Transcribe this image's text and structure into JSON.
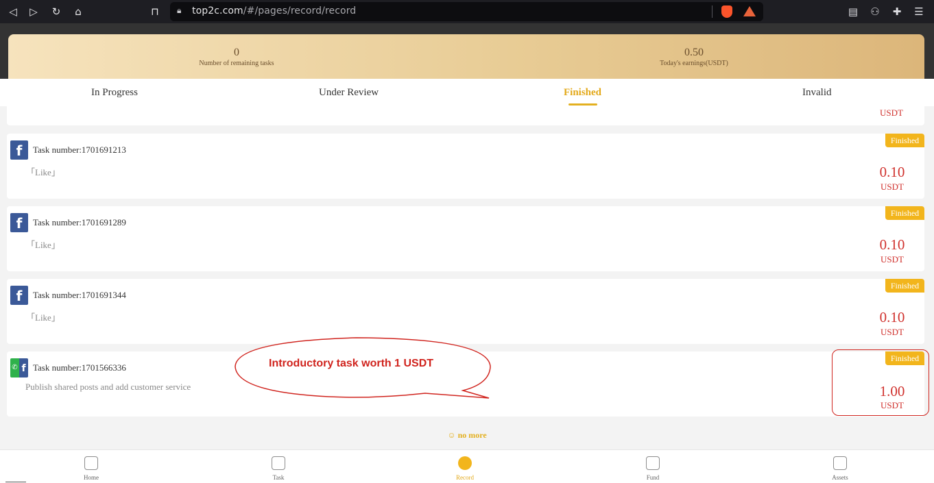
{
  "browser": {
    "url_host": "top2c.com",
    "url_path": "/#/pages/record/record"
  },
  "header": {
    "remaining_value": "0",
    "remaining_label": "Number of remaining tasks",
    "earnings_value": "0.50",
    "earnings_label": "Today's earnings(USDT)"
  },
  "tabs": [
    "In Progress",
    "Under Review",
    "Finished",
    "Invalid"
  ],
  "partial_card": {
    "unit": "USDT"
  },
  "records": [
    {
      "task_label": "Task number:1701691213",
      "desc": "「Like」",
      "status": "Finished",
      "amount": "0.10",
      "unit": "USDT"
    },
    {
      "task_label": "Task number:1701691289",
      "desc": "「Like」",
      "status": "Finished",
      "amount": "0.10",
      "unit": "USDT"
    },
    {
      "task_label": "Task number:1701691344",
      "desc": "「Like」",
      "status": "Finished",
      "amount": "0.10",
      "unit": "USDT"
    },
    {
      "task_label": "Task number:1701566336",
      "desc": "Publish shared posts and add customer service",
      "status": "Finished",
      "amount": "1.00",
      "unit": "USDT"
    }
  ],
  "annotation": {
    "callout_text": "Introductory task worth 1 USDT"
  },
  "no_more": "☺ no more",
  "bottom_nav": [
    "Home",
    "Task",
    "Record",
    "Fund",
    "Assets"
  ],
  "colors": {
    "accent": "#f2b51c",
    "amount": "#d0312d",
    "facebook": "#3b5998",
    "whatsapp": "#2fb14b"
  }
}
